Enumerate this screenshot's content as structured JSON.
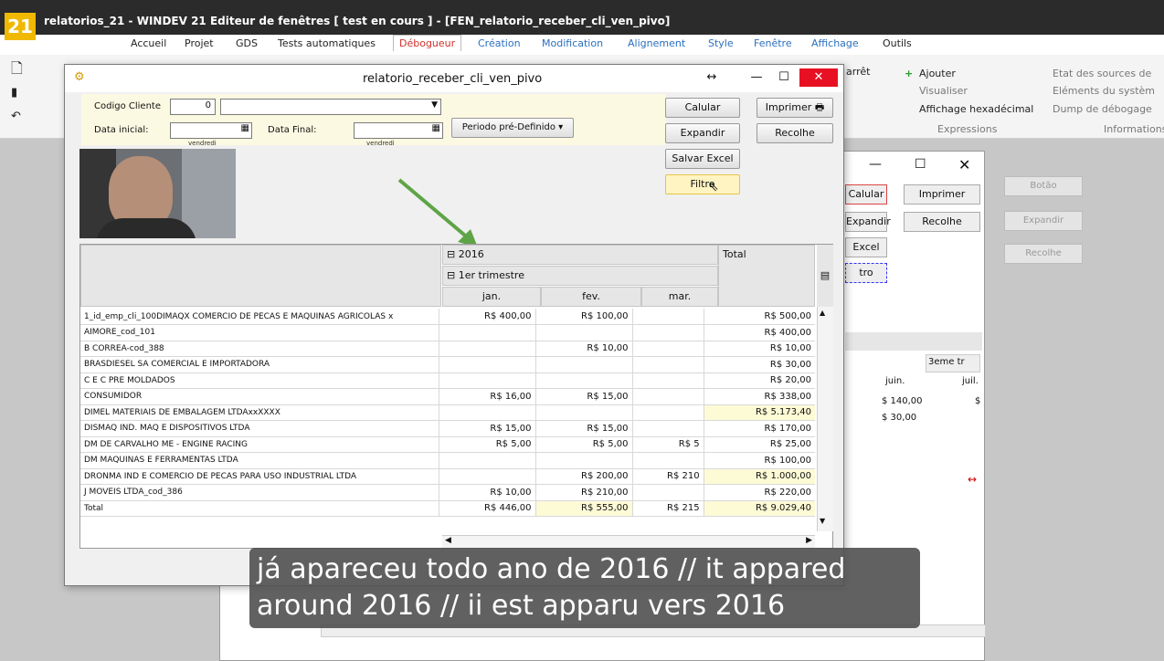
{
  "app": {
    "logo": "21",
    "title": "relatorios_21 - WINDEV 21  Editeur de fenêtres [ test en cours ] - [FEN_relatorio_receber_cli_ven_pivo]"
  },
  "menu": [
    "Accueil",
    "Projet",
    "GDS",
    "Tests automatiques",
    "Débogueur",
    "Création",
    "Modification",
    "Alignement",
    "Style",
    "Fenêtre",
    "Affichage",
    "Outils"
  ],
  "ribbon": {
    "arret": "arrêt",
    "ajouter": "Ajouter",
    "visualiser": "Visualiser",
    "affichage_hex": "Affichage hexadécimal",
    "expressions": "Expressions",
    "etat_sources": "Etat des sources de",
    "elements_systeme": "Eléments du systèm",
    "dump": "Dump de débogage",
    "informations": "Informations"
  },
  "background_window": {
    "calular": "Calular",
    "imprimer": "Imprimer",
    "expandir": "Expandir",
    "recolhe": "Recolhe",
    "excel": "Excel",
    "filtro": "tro",
    "col_header": "3eme tr",
    "months": [
      "juin.",
      "juil."
    ],
    "vals": [
      "$ 140,00",
      "$ 30,00",
      "$"
    ],
    "ghost": [
      "Botão",
      "Expandir",
      "Recolhe"
    ]
  },
  "dialog": {
    "title": "relatorio_receber_cli_ven_pivo",
    "codigo_label": "Codigo Cliente",
    "codigo_value": "0",
    "data_inicial_label": "Data inicial:",
    "data_final_label": "Data Final:",
    "weekday": "vendredi",
    "periodo": "Periodo pré-Definido",
    "buttons": {
      "calular": "Calular",
      "imprimer": "Imprimer",
      "expandir": "Expandir",
      "recolhe": "Recolhe",
      "salvar_excel": "Salvar Excel",
      "filtro": "Filtro"
    }
  },
  "pivot": {
    "year": "2016",
    "quarter": "1er trimestre",
    "total_header": "Total",
    "months": [
      "jan.",
      "fev.",
      "mar."
    ],
    "rows": [
      {
        "name": "1_id_emp_cli_100DIMAQX COMERCIO DE PECAS E MAQUINAS AGRICOLAS x",
        "jan": "R$ 400,00",
        "fev": "R$ 100,00",
        "mar": "",
        "total": "R$ 500,00"
      },
      {
        "name": "AIMORE_cod_101",
        "jan": "",
        "fev": "",
        "mar": "",
        "total": "R$ 400,00"
      },
      {
        "name": "B CORREA-cod_388",
        "jan": "",
        "fev": "R$ 10,00",
        "mar": "",
        "total": "R$ 10,00"
      },
      {
        "name": "BRASDIESEL SA COMERCIAL E IMPORTADORA",
        "jan": "",
        "fev": "",
        "mar": "",
        "total": "R$ 30,00"
      },
      {
        "name": "C E C PRE MOLDADOS",
        "jan": "",
        "fev": "",
        "mar": "",
        "total": "R$ 20,00"
      },
      {
        "name": "CONSUMIDOR",
        "jan": "R$ 16,00",
        "fev": "R$ 15,00",
        "mar": "",
        "total": "R$ 338,00"
      },
      {
        "name": "DIMEL MATERIAIS DE EMBALAGEM LTDAxxXXXX",
        "jan": "",
        "fev": "",
        "mar": "",
        "total": "R$ 5.173,40"
      },
      {
        "name": "DISMAQ IND. MAQ E DISPOSITIVOS LTDA",
        "jan": "R$ 15,00",
        "fev": "R$ 15,00",
        "mar": "",
        "total": "R$ 170,00"
      },
      {
        "name": "DM DE CARVALHO ME - ENGINE RACING",
        "jan": "R$ 5,00",
        "fev": "R$ 5,00",
        "mar": "R$ 5",
        "total": "R$ 25,00"
      },
      {
        "name": "DM MAQUINAS E FERRAMENTAS LTDA",
        "jan": "",
        "fev": "",
        "mar": "",
        "total": "R$ 100,00"
      },
      {
        "name": "DRONMA IND E COMERCIO DE PECAS PARA USO INDUSTRIAL LTDA",
        "jan": "",
        "fev": "R$ 200,00",
        "mar": "R$ 210",
        "total": "R$ 1.000,00"
      },
      {
        "name": "J MOVEIS LTDA_cod_386",
        "jan": "R$ 10,00",
        "fev": "R$ 210,00",
        "mar": "",
        "total": "R$ 220,00"
      }
    ],
    "total_row": {
      "name": "Total",
      "jan": "R$ 446,00",
      "fev": "R$ 555,00",
      "mar": "R$ 215",
      "total": "R$ 9.029,40"
    }
  },
  "subtitle": "já apareceu todo ano de 2016 // it appared around 2016 // ii est apparu vers 2016"
}
